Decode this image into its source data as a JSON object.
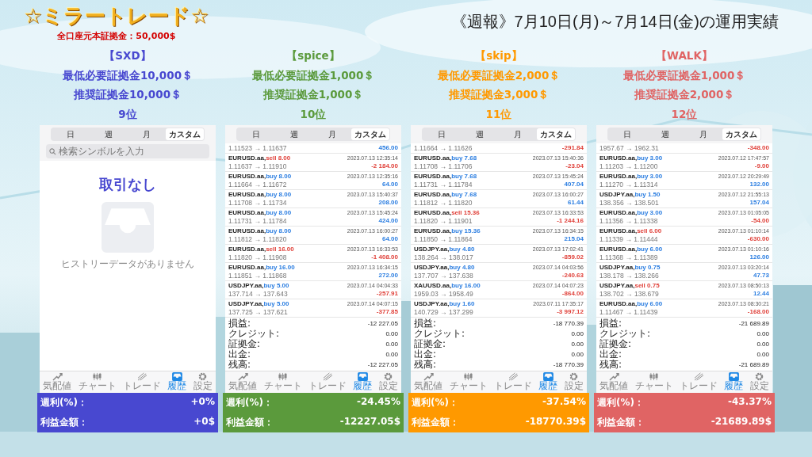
{
  "header": {
    "title": "☆ミラートレード☆",
    "subtitle": "全口座元本証拠金：50,000$",
    "report_title": "《週報》7月10日(月)～7月14日(金)の運用実績"
  },
  "accounts": [
    {
      "name": "【SXD】",
      "color": "#4848d0",
      "min_margin": "最低必要証拠金10,000＄",
      "recommended": "推奨証拠金10,000＄",
      "rank": "9位",
      "kind": "empty",
      "periods": [
        {
          "label": "日",
          "selected": false
        },
        {
          "label": "週",
          "selected": false
        },
        {
          "label": "月",
          "selected": false
        },
        {
          "label": "カスタム",
          "selected": true
        }
      ],
      "search_placeholder": "検索シンボルを入力",
      "empty_title": "取引なし",
      "empty_message": "ヒストリーデータがありません",
      "nav": [
        {
          "label": "気配値",
          "selected": false
        },
        {
          "label": "チャート",
          "selected": false
        },
        {
          "label": "トレード",
          "selected": false
        },
        {
          "label": "履歴",
          "selected": true
        },
        {
          "label": "設定",
          "selected": false
        }
      ],
      "weekly": {
        "label": "週利(%)：",
        "value": "+0%"
      },
      "profit": {
        "label": "利益金額：",
        "value": "+0$"
      }
    },
    {
      "name": "【spice】",
      "color": "#5b9a3c",
      "min_margin": "最低必要証拠金1,000＄",
      "recommended": "推奨証拠金1,000＄",
      "rank": "10位",
      "kind": "trades",
      "periods": [
        {
          "label": "日",
          "selected": false
        },
        {
          "label": "週",
          "selected": false
        },
        {
          "label": "月",
          "selected": false
        },
        {
          "label": "カスタム",
          "selected": true
        }
      ],
      "trades": [
        {
          "prices": "1.11523 → 1.11637",
          "profit": "456.00",
          "loss": false
        },
        {
          "symbol": "EURUSD.aa,",
          "order": "sell 8.00",
          "sell": true,
          "time": "2023.07.13 12:35:14",
          "prices": "1.11637 → 1.11910",
          "profit": "-2 184.00",
          "loss": true
        },
        {
          "symbol": "EURUSD.aa,",
          "order": "buy 8.00",
          "sell": false,
          "time": "2023.07.13 12:35:16",
          "prices": "1.11664 → 1.11672",
          "profit": "64.00",
          "loss": false
        },
        {
          "symbol": "EURUSD.aa,",
          "order": "buy 8.00",
          "sell": false,
          "time": "2023.07.13 15:40:37",
          "prices": "1.11708 → 1.11734",
          "profit": "208.00",
          "loss": false
        },
        {
          "symbol": "EURUSD.aa,",
          "order": "buy 8.00",
          "sell": false,
          "time": "2023.07.13 15:45:24",
          "prices": "1.11731 → 1.11784",
          "profit": "424.00",
          "loss": false
        },
        {
          "symbol": "EURUSD.aa,",
          "order": "buy 8.00",
          "sell": false,
          "time": "2023.07.13 16:00:27",
          "prices": "1.11812 → 1.11820",
          "profit": "64.00",
          "loss": false
        },
        {
          "symbol": "EURUSD.aa,",
          "order": "sell 16.00",
          "sell": true,
          "time": "2023.07.13 16:33:53",
          "prices": "1.11820 → 1.11908",
          "profit": "-1 408.00",
          "loss": true
        },
        {
          "symbol": "EURUSD.aa,",
          "order": "buy 16.00",
          "sell": false,
          "time": "2023.07.13 16:34:15",
          "prices": "1.11851 → 1.11868",
          "profit": "272.00",
          "loss": false
        },
        {
          "symbol": "USDJPY.aa,",
          "order": "buy 5.00",
          "sell": false,
          "time": "2023.07.14 04:04:33",
          "prices": "137.714 → 137.643",
          "profit": "-257.91",
          "loss": true
        },
        {
          "symbol": "USDJPY.aa,",
          "order": "buy 5.00",
          "sell": false,
          "time": "2023.07.14 04:07:15",
          "prices": "137.725 → 137.621",
          "profit": "-377.85",
          "loss": true
        }
      ],
      "summary": [
        {
          "label": "損益:",
          "value": "-12 227.05"
        },
        {
          "label": "クレジット:",
          "value": "0.00"
        },
        {
          "label": "証拠金:",
          "value": "0.00"
        },
        {
          "label": "出金:",
          "value": "0.00"
        },
        {
          "label": "残高:",
          "value": "-12 227.05"
        }
      ],
      "nav": [
        {
          "label": "気配値",
          "selected": false
        },
        {
          "label": "チャート",
          "selected": false
        },
        {
          "label": "トレード",
          "selected": false
        },
        {
          "label": "履歴",
          "selected": true
        },
        {
          "label": "設定",
          "selected": false
        }
      ],
      "weekly": {
        "label": "週利(%)：",
        "value": "-24.45%"
      },
      "profit": {
        "label": "利益金額：",
        "value": "-12227.05$"
      }
    },
    {
      "name": "【skip】",
      "color": "#ff9900",
      "min_margin": "最低必要証拠金2,000＄",
      "recommended": "推奨証拠金3,000＄",
      "rank": "11位",
      "kind": "trades",
      "periods": [
        {
          "label": "日",
          "selected": false
        },
        {
          "label": "週",
          "selected": false
        },
        {
          "label": "月",
          "selected": false
        },
        {
          "label": "カスタム",
          "selected": true
        }
      ],
      "trades": [
        {
          "prices": "1.11664 → 1.11626",
          "profit": "-291.84",
          "loss": true
        },
        {
          "symbol": "EURUSD.aa,",
          "order": "buy 7.68",
          "sell": false,
          "time": "2023.07.13 15:40:36",
          "prices": "1.11708 → 1.11706",
          "profit": "-23.04",
          "loss": true
        },
        {
          "symbol": "EURUSD.aa,",
          "order": "buy 7.68",
          "sell": false,
          "time": "2023.07.13 15:45:24",
          "prices": "1.11731 → 1.11784",
          "profit": "407.04",
          "loss": false
        },
        {
          "symbol": "EURUSD.aa,",
          "order": "buy 7.68",
          "sell": false,
          "time": "2023.07.13 16:00:27",
          "prices": "1.11812 → 1.11820",
          "profit": "61.44",
          "loss": false
        },
        {
          "symbol": "EURUSD.aa,",
          "order": "sell 15.36",
          "sell": true,
          "time": "2023.07.13 16:33:53",
          "prices": "1.11820 → 1.11901",
          "profit": "-1 244.16",
          "loss": true
        },
        {
          "symbol": "EURUSD.aa,",
          "order": "buy 15.36",
          "sell": false,
          "time": "2023.07.13 16:34:15",
          "prices": "1.11850 → 1.11864",
          "profit": "215.04",
          "loss": false
        },
        {
          "symbol": "USDJPY.aa,",
          "order": "buy 4.80",
          "sell": false,
          "time": "2023.07.13 17:02:41",
          "prices": "138.264 → 138.017",
          "profit": "-859.02",
          "loss": true
        },
        {
          "symbol": "USDJPY.aa,",
          "order": "buy 4.80",
          "sell": false,
          "time": "2023.07.14 04:03:56",
          "prices": "137.707 → 137.638",
          "profit": "-240.63",
          "loss": true
        },
        {
          "symbol": "XAUUSD.aa,",
          "order": "buy 16.00",
          "sell": false,
          "time": "2023.07.14 04:07:23",
          "prices": "1959.03 → 1958.49",
          "profit": "-864.00",
          "loss": true
        },
        {
          "symbol": "USDJPY.aa,",
          "order": "buy 1.60",
          "sell": false,
          "time": "2023.07.11 17:35:17",
          "prices": "140.729 → 137.299",
          "profit": "-3 997.12",
          "loss": true
        }
      ],
      "summary": [
        {
          "label": "損益:",
          "value": "-18 770.39"
        },
        {
          "label": "クレジット:",
          "value": "0.00"
        },
        {
          "label": "証拠金:",
          "value": "0.00"
        },
        {
          "label": "出金:",
          "value": "0.00"
        },
        {
          "label": "残高:",
          "value": "-18 770.39"
        }
      ],
      "nav": [
        {
          "label": "気配値",
          "selected": false
        },
        {
          "label": "チャート",
          "selected": false
        },
        {
          "label": "トレード",
          "selected": false
        },
        {
          "label": "履歴",
          "selected": true
        },
        {
          "label": "設定",
          "selected": false
        }
      ],
      "weekly": {
        "label": "週利(%)：",
        "value": "-37.54%"
      },
      "profit": {
        "label": "利益金額：",
        "value": "-18770.39$"
      }
    },
    {
      "name": "【WALK】",
      "color": "#e06464",
      "min_margin": "最低必要証拠金1,000＄",
      "recommended": "推奨証拠金2,000＄",
      "rank": "12位",
      "kind": "trades",
      "periods": [
        {
          "label": "日",
          "selected": false
        },
        {
          "label": "週",
          "selected": false
        },
        {
          "label": "月",
          "selected": false
        },
        {
          "label": "カスタム",
          "selected": true
        }
      ],
      "trades": [
        {
          "prices": "1957.67 → 1962.31",
          "profit": "-348.00",
          "loss": true
        },
        {
          "symbol": "EURUSD.aa,",
          "order": "buy 3.00",
          "sell": false,
          "time": "2023.07.12 17:47:57",
          "prices": "1.11203 → 1.11200",
          "profit": "-9.00",
          "loss": true
        },
        {
          "symbol": "EURUSD.aa,",
          "order": "buy 3.00",
          "sell": false,
          "time": "2023.07.12 20:29:49",
          "prices": "1.11270 → 1.11314",
          "profit": "132.00",
          "loss": false
        },
        {
          "symbol": "USDJPY.aa,",
          "order": "buy 1.50",
          "sell": false,
          "time": "2023.07.12 21:55:13",
          "prices": "138.356 → 138.501",
          "profit": "157.04",
          "loss": false
        },
        {
          "symbol": "EURUSD.aa,",
          "order": "buy 3.00",
          "sell": false,
          "time": "2023.07.13 01:05:05",
          "prices": "1.11356 → 1.11338",
          "profit": "-54.00",
          "loss": true
        },
        {
          "symbol": "EURUSD.aa,",
          "order": "sell 6.00",
          "sell": true,
          "time": "2023.07.13 01:10:14",
          "prices": "1.11339 → 1.11444",
          "profit": "-630.00",
          "loss": true
        },
        {
          "symbol": "EURUSD.aa,",
          "order": "buy 6.00",
          "sell": false,
          "time": "2023.07.13 01:10:16",
          "prices": "1.11368 → 1.11389",
          "profit": "126.00",
          "loss": false
        },
        {
          "symbol": "USDJPY.aa,",
          "order": "buy 0.75",
          "sell": false,
          "time": "2023.07.13 03:20:14",
          "prices": "138.178 → 138.266",
          "profit": "47.73",
          "loss": false
        },
        {
          "symbol": "USDJPY.aa,",
          "order": "sell 0.75",
          "sell": true,
          "time": "2023.07.13 08:50:13",
          "prices": "138.702 → 138.679",
          "profit": "12.44",
          "loss": false
        },
        {
          "symbol": "EURUSD.aa,",
          "order": "buy 6.00",
          "sell": false,
          "time": "2023.07.13 08:30:21",
          "prices": "1.11467 → 1.11439",
          "profit": "-168.00",
          "loss": true
        }
      ],
      "summary": [
        {
          "label": "損益:",
          "value": "-21 689.89"
        },
        {
          "label": "クレジット:",
          "value": "0.00"
        },
        {
          "label": "証拠金:",
          "value": "0.00"
        },
        {
          "label": "出金:",
          "value": "0.00"
        },
        {
          "label": "残高:",
          "value": "-21 689.89"
        }
      ],
      "nav": [
        {
          "label": "気配値",
          "selected": false
        },
        {
          "label": "チャート",
          "selected": false
        },
        {
          "label": "トレード",
          "selected": false
        },
        {
          "label": "履歴",
          "selected": true
        },
        {
          "label": "設定",
          "selected": false
        }
      ],
      "weekly": {
        "label": "週利(%)：",
        "value": "-43.37%"
      },
      "profit": {
        "label": "利益金額：",
        "value": "-21689.89$"
      }
    }
  ]
}
